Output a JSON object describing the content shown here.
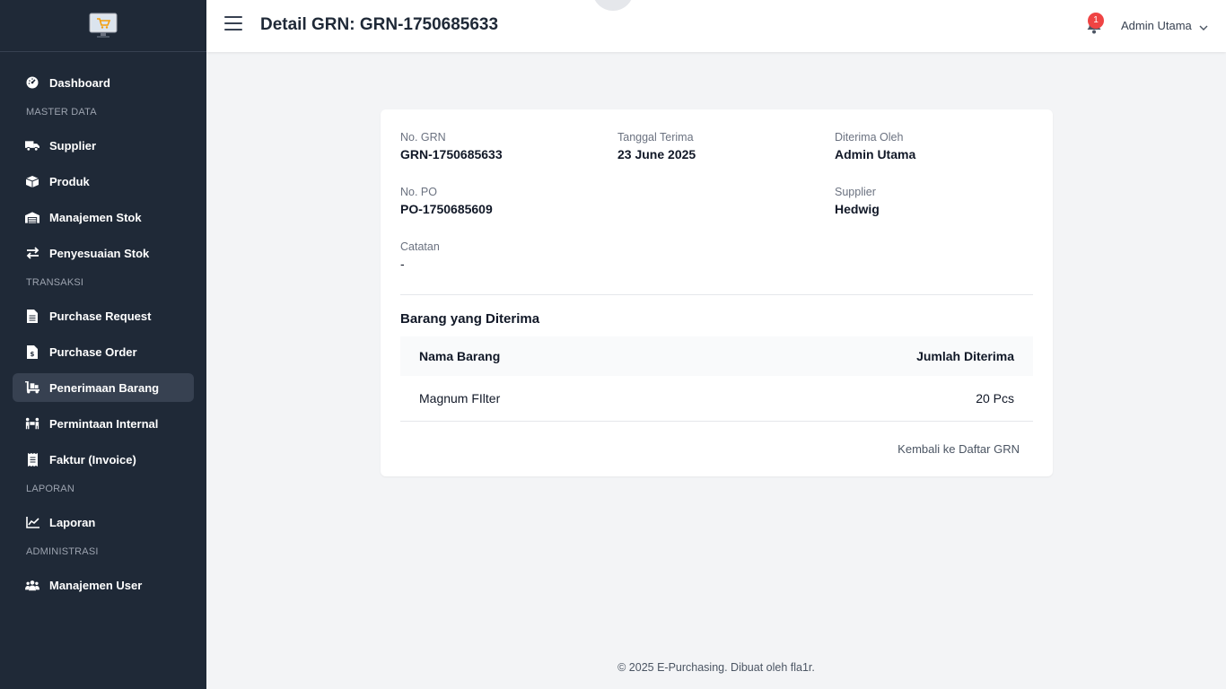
{
  "header": {
    "title": "Detail GRN: GRN-1750685633",
    "notification_count": "1",
    "user_name": "Admin Utama"
  },
  "sidebar": {
    "items": [
      {
        "label": "Dashboard",
        "icon": "dashboard-icon"
      },
      {
        "section": "MASTER DATA"
      },
      {
        "label": "Supplier",
        "icon": "truck-icon"
      },
      {
        "label": "Produk",
        "icon": "box-icon"
      },
      {
        "label": "Manajemen Stok",
        "icon": "warehouse-icon"
      },
      {
        "label": "Penyesuaian Stok",
        "icon": "exchange-icon"
      },
      {
        "section": "TRANSAKSI"
      },
      {
        "label": "Purchase Request",
        "icon": "file-icon"
      },
      {
        "label": "Purchase Order",
        "icon": "file-invoice-icon"
      },
      {
        "label": "Penerimaan Barang",
        "icon": "dolly-icon",
        "active": true
      },
      {
        "label": "Permintaan Internal",
        "icon": "people-carry-icon"
      },
      {
        "label": "Faktur (Invoice)",
        "icon": "receipt-icon"
      },
      {
        "section": "LAPORAN"
      },
      {
        "label": "Laporan",
        "icon": "chart-line-icon"
      },
      {
        "section": "ADMINISTRASI"
      },
      {
        "label": "Manajemen User",
        "icon": "users-icon"
      }
    ]
  },
  "detail": {
    "no_grn_label": "No. GRN",
    "no_grn": "GRN-1750685633",
    "tanggal_label": "Tanggal Terima",
    "tanggal": "23 June 2025",
    "diterima_label": "Diterima Oleh",
    "diterima": "Admin Utama",
    "no_po_label": "No. PO",
    "no_po": "PO-1750685609",
    "supplier_label": "Supplier",
    "supplier": "Hedwig",
    "catatan_label": "Catatan",
    "catatan": "-"
  },
  "items_section": {
    "title": "Barang yang Diterima",
    "columns": [
      "Nama Barang",
      "Jumlah Diterima"
    ],
    "rows": [
      {
        "name": "Magnum FIlter",
        "qty": "20 Pcs"
      }
    ],
    "back_link": "Kembali ke Daftar GRN"
  },
  "footer": {
    "text": "© 2025 E-Purchasing. Dibuat oleh fla1r."
  },
  "colors": {
    "sidebar_bg": "#1f2937",
    "active_item_bg": "#374151",
    "badge": "#ef4444",
    "page_bg": "#f3f4f6"
  }
}
